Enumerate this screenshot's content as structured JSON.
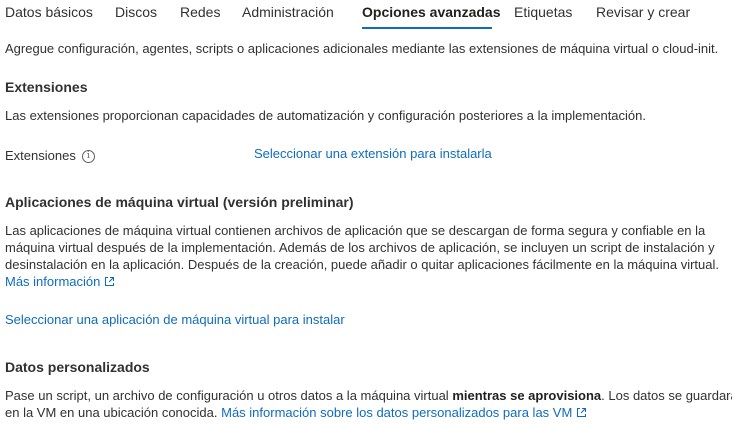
{
  "tabs": [
    {
      "label": "Datos básicos"
    },
    {
      "label": "Discos"
    },
    {
      "label": "Redes"
    },
    {
      "label": "Administración"
    },
    {
      "label": "Opciones avanzadas"
    },
    {
      "label": "Etiquetas"
    },
    {
      "label": "Revisar y crear"
    }
  ],
  "active_tab": "Opciones avanzadas",
  "intro": "Agregue configuración, agentes, scripts o aplicaciones adicionales mediante las extensiones de máquina virtual o cloud-init.",
  "extensions": {
    "heading": "Extensiones",
    "description": "Las extensiones proporcionan capacidades de automatización y configuración posteriores a la implementación.",
    "field_label": "Extensiones",
    "select_link": "Seleccionar una extensión para instalarla"
  },
  "vm_apps": {
    "heading": "Aplicaciones de máquina virtual (versión preliminar)",
    "line1": "Las aplicaciones de máquina virtual contienen archivos de aplicación que se descargan de forma segura y confiable en la",
    "line2": "máquina virtual después de la implementación. Además de los archivos de aplicación, se incluyen un script de instalación y",
    "line3": "desinstalación en la aplicación. Después de la creación, puede añadir o quitar aplicaciones fácilmente en la máquina virtual.",
    "more_info": "Más información",
    "select_link": "Seleccionar una aplicación de máquina virtual para instalar"
  },
  "custom_data": {
    "heading": "Datos personalizados",
    "line1_start": "Pase un script, un archivo de configuración u otros datos a la máquina virtual ",
    "line1_bold": "mientras se aprovisiona",
    "line1_end": ". Los datos se guardarán",
    "line2_start": "en la VM en una ubicación conocida.",
    "more_info": "Más información sobre los datos personalizados para las VM"
  },
  "colors": {
    "accent": "#0f6cbd",
    "text": "#323130"
  }
}
